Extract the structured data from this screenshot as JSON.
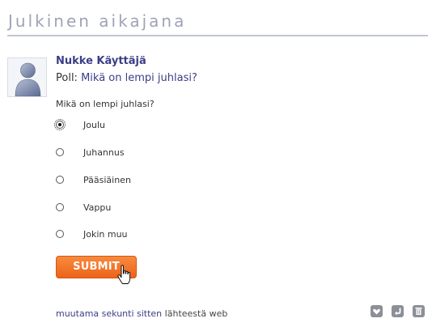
{
  "header": {
    "title": "Julkinen aikajana"
  },
  "post": {
    "author": "Nukke Käyttäjä",
    "poll_prefix": "Poll:",
    "poll_title": "Mikä on lempi juhlasi?",
    "question": "Mikä on lempi juhlasi?",
    "options": [
      {
        "label": "Joulu",
        "selected": true
      },
      {
        "label": "Juhannus",
        "selected": false
      },
      {
        "label": "Pääsiäinen",
        "selected": false
      },
      {
        "label": "Vappu",
        "selected": false
      },
      {
        "label": "Jokin muu",
        "selected": false
      }
    ],
    "submit_label": "SUBMIT",
    "timestamp": "muutama sekunti sitten",
    "source_text": "lähteestä web"
  },
  "actions": [
    {
      "icon": "heart-icon"
    },
    {
      "icon": "repost-icon"
    },
    {
      "icon": "trash-icon"
    }
  ],
  "colors": {
    "title_gray": "#9fa3b6",
    "link_blue": "#3b3e87",
    "submit_orange": "#ec6419"
  }
}
